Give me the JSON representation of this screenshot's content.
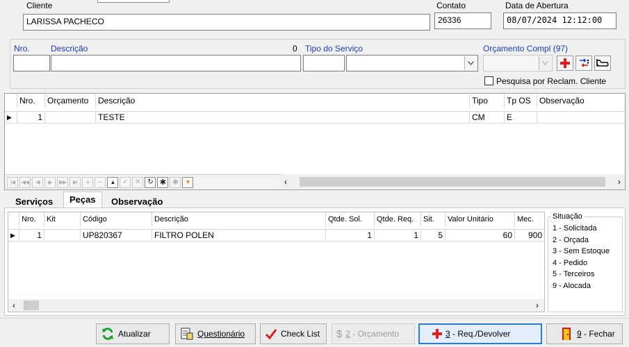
{
  "header": {
    "cliente_label": "Cliente",
    "cliente_value": "LARISSA PACHECO",
    "contato_label": "Contato",
    "contato_value": "26336",
    "data_label": "Data de Abertura",
    "data_value": "08/07/2024 12:12:00"
  },
  "entry": {
    "nro_label": "Nro.",
    "descricao_label": "Descrição",
    "count_value": "0",
    "tipo_servico_label": "Tipo do Serviço",
    "orcamento_label": "Orçamento Compl (97)",
    "pesquisa_label": "Pesquisa por Reclam. Cliente",
    "nro_value": "",
    "descricao_value": "",
    "tipo_code_value": "",
    "tipo_select_value": "",
    "orcamento_select_value": ""
  },
  "services_grid": {
    "columns": [
      "Nro.",
      "Orçamento",
      "Descrição",
      "Tipo",
      "Tp OS",
      "Observação"
    ],
    "rows": [
      {
        "nro": "1",
        "orcamento": "",
        "descricao": "TESTE",
        "tipo": "CM",
        "tp_os": "E",
        "observacao": ""
      }
    ]
  },
  "tabs": [
    "Serviços",
    "Peças",
    "Observação"
  ],
  "active_tab": "Peças",
  "parts_grid": {
    "columns": [
      "Nro.",
      "Kit",
      "Código",
      "Descrição",
      "Qtde. Sol.",
      "Qtde. Req.",
      "Sit.",
      "Valor Unitário",
      "Mec."
    ],
    "rows": [
      {
        "nro": "1",
        "kit": "",
        "codigo": "UP820367",
        "descricao": "FILTRO POLEN",
        "qtde_sol": "1",
        "qtde_req": "1",
        "sit": "5",
        "valor": "60",
        "mec": "900"
      }
    ]
  },
  "situacao": {
    "title": "Situação",
    "items": [
      "1 - Solicitada",
      "2 - Orçada",
      "3 - Sem Estoque",
      "4 - Pedido",
      "5 - Terceiros",
      "9 - Alocada"
    ]
  },
  "buttons": {
    "atualizar": "Atualizar",
    "questionario": "Questionário",
    "check_list": "Check List",
    "orcamento_key": "2",
    "orcamento": " - Orçamento",
    "req_key": "3",
    "req": " - Req./Devolver",
    "fechar_key": "9",
    "fechar": " - Fechar"
  },
  "colors": {
    "label_blue": "#1a3bb8",
    "add_red": "#e02020",
    "focus_blue": "#2a7ad8",
    "checkmark_red": "#d42020",
    "refresh_green": "#1e9a2e"
  },
  "icons": {
    "add": "red-cross-icon",
    "transfer": "transfer-arrows-icon",
    "vehicle": "car-lift-icon",
    "refresh": "refresh-icon",
    "questionnaire": "questionnaire-icon",
    "check": "checkmark-icon",
    "dollar": "dollar-icon",
    "exit": "exit-door-icon"
  }
}
